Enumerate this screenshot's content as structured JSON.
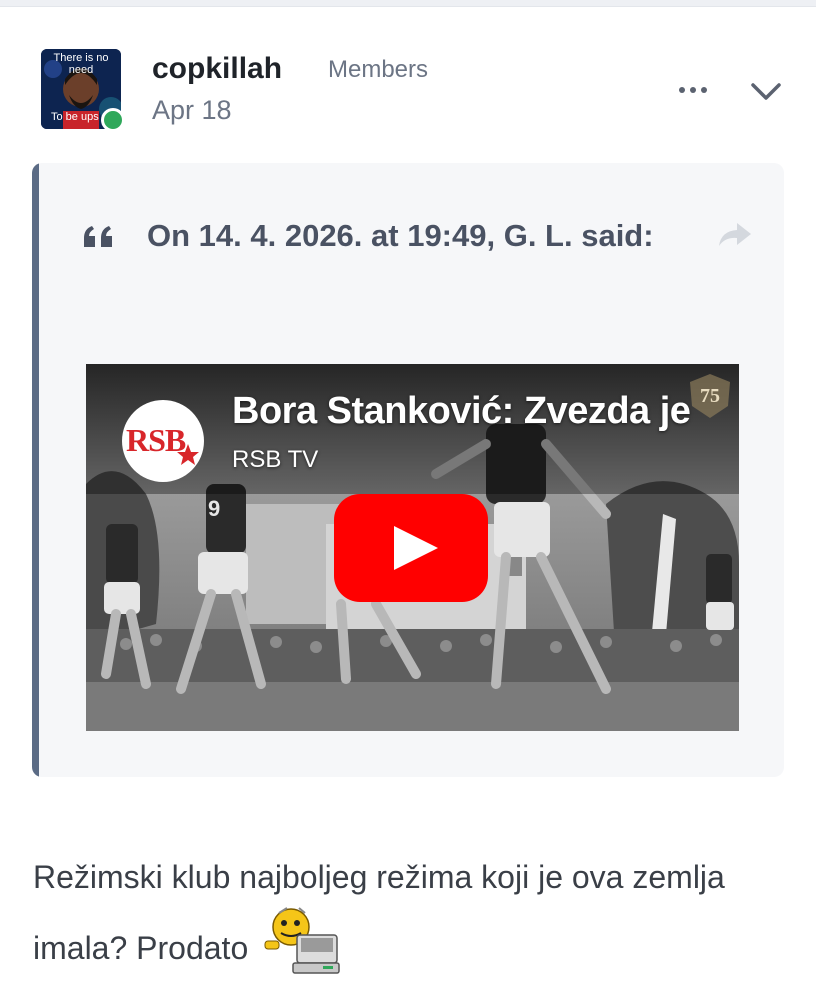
{
  "post": {
    "author": "copkillah",
    "group": "Members",
    "date": "Apr 18",
    "avatar": {
      "top_caption": "There is no need",
      "bottom_caption": "To be ups"
    },
    "online_status_color": "#2fa85a",
    "menu_icon": "ellipsis-icon",
    "collapse_icon": "chevron-down-icon"
  },
  "quote": {
    "citation": "On 14. 4. 2026. at 19:49, G. L. said:",
    "quote_icon": "quote-mark-icon",
    "share_icon": "share-arrow-icon",
    "accent_color": "#5b6b85",
    "video": {
      "title": "Bora Stanković: Zvezda je",
      "channel": "RSB TV",
      "channel_logo_text": "RSB",
      "play_icon": "youtube-play-icon",
      "badge_text": "75"
    }
  },
  "body": {
    "text": "Režimski klub najboljeg režima koji je ova zemlja imala? Prodato",
    "emoji": "computer-smiley-icon"
  }
}
